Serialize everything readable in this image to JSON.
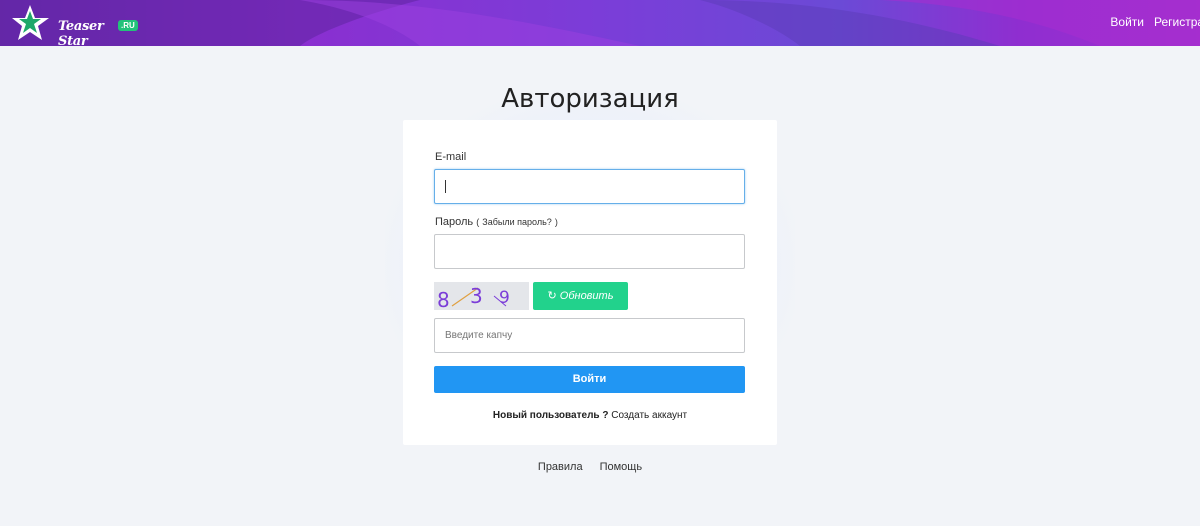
{
  "header": {
    "logo_text": "Teaser Star",
    "logo_badge": ".RU",
    "nav": {
      "login": "Войти",
      "register": "Регистрация"
    }
  },
  "page_title": "Авторизация",
  "form": {
    "email_label": "E-mail",
    "email_value": "",
    "password_label": "Пароль",
    "forgot_open": "(",
    "forgot_link": "Забыли пароль?",
    "forgot_close": ")",
    "password_value": "",
    "captcha_digits": [
      "8",
      "3",
      "9"
    ],
    "refresh_label": "Обновить",
    "refresh_icon": "refresh-icon",
    "captcha_placeholder": "Введите капчу",
    "submit_label": "Войти",
    "new_user_text": "Новый пользователь ?",
    "create_account_link": "Создать аккаунт"
  },
  "footer": {
    "rules": "Правила",
    "help": "Помощь"
  },
  "colors": {
    "header_purple": "#8a2fd0",
    "logo_green": "#23c27a",
    "refresh_green": "#22d28c",
    "submit_blue": "#2196f3",
    "captcha_purple": "#7b3dd8"
  }
}
